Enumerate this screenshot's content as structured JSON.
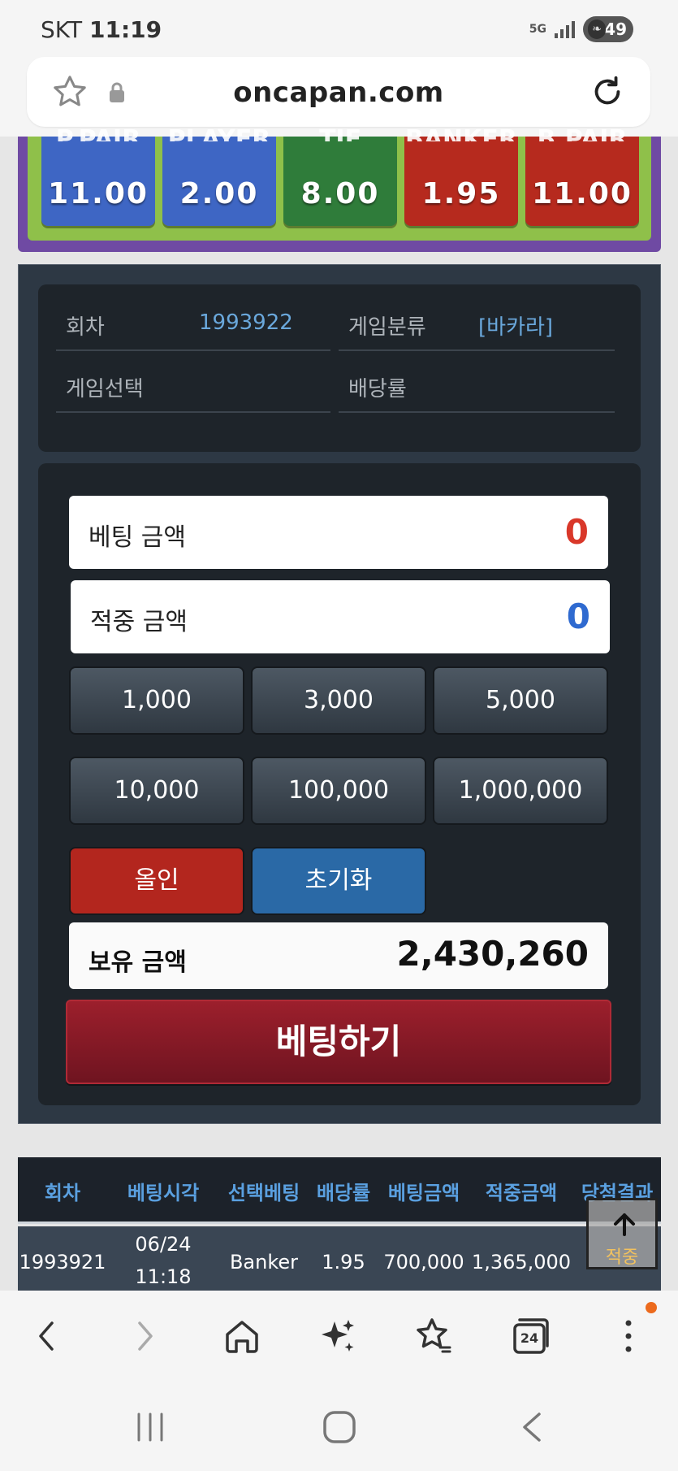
{
  "status": {
    "carrier": "SKT",
    "time": "11:19",
    "network": "5G",
    "battery": "49"
  },
  "browser": {
    "url": "oncapan.com",
    "tabs_count": "24"
  },
  "odds": [
    {
      "peek": "P.PAIR",
      "value": "11.00",
      "color": "#3e66c4"
    },
    {
      "peek": "PLAYER",
      "value": "2.00",
      "color": "#3e66c4"
    },
    {
      "peek": "TIE",
      "value": "8.00",
      "color": "#2f7c3a"
    },
    {
      "peek": "BANKER",
      "value": "1.95",
      "color": "#b62a1e"
    },
    {
      "peek": "B.PAIR",
      "value": "11.00",
      "color": "#b62a1e"
    }
  ],
  "info": {
    "round_label": "회차",
    "round_value": "1993922",
    "category_label": "게임분류",
    "category_value": "[바카라]",
    "select_label": "게임선택",
    "select_value": "",
    "odds_label": "배당률",
    "odds_value": ""
  },
  "bet": {
    "bet_amount_label": "베팅 금액",
    "bet_amount_value": "0",
    "win_amount_label": "적중 금액",
    "win_amount_value": "0",
    "chips": [
      "1,000",
      "3,000",
      "5,000",
      "10,000",
      "100,000",
      "1,000,000"
    ],
    "allin_label": "올인",
    "reset_label": "초기화",
    "balance_label": "보유 금액",
    "balance_value": "2,430,260",
    "submit_label": "베팅하기"
  },
  "history": {
    "headers": [
      "회차",
      "베팅시각",
      "선택베팅",
      "배당률",
      "베팅금액",
      "적중금액",
      "당첨결과"
    ],
    "rows": [
      {
        "round": "1993921",
        "date": "06/24",
        "time": "11:18",
        "pick": "Banker",
        "odds": "1.95",
        "bet": "700,000",
        "win": "1,365,000",
        "result": "적중"
      }
    ]
  },
  "colors": {
    "accent_blue": "#6aa8dc",
    "bet_red": "#d9382a",
    "win_blue": "#2f6ad0"
  }
}
